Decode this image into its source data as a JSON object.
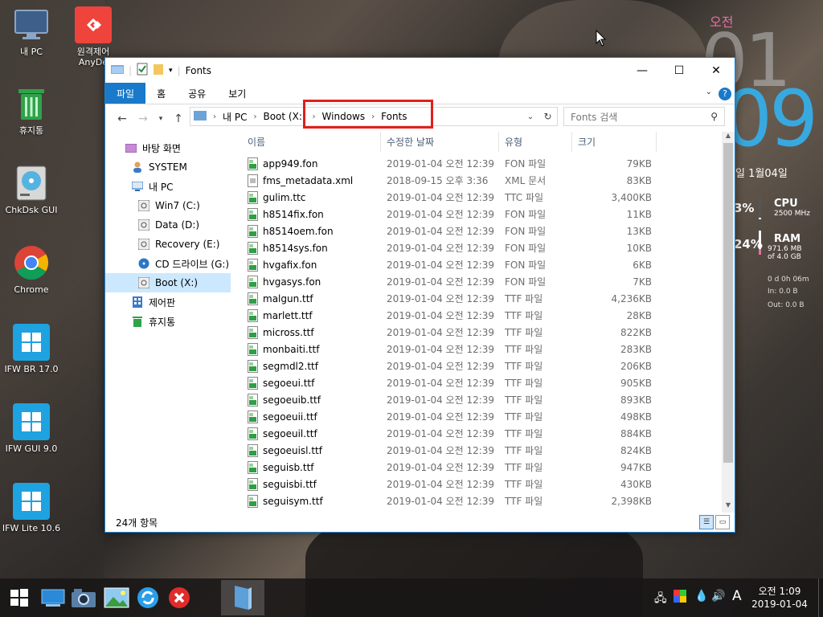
{
  "desktop": {
    "icons": [
      {
        "label": "내 PC"
      },
      {
        "label": "원격제어\nAnyDe"
      },
      {
        "label": "휴지통"
      },
      {
        "label": "ChkDsk GUI"
      },
      {
        "label": "Chrome"
      },
      {
        "label": "IFW BR 17.0"
      },
      {
        "label": "IFW GUI 9.0"
      },
      {
        "label": "IFW Lite 10.6"
      }
    ]
  },
  "widget": {
    "ampm": "오전",
    "hour": "01",
    "minute": "09",
    "date": "일 1월04일",
    "cpu": {
      "pct": "3%",
      "title": "CPU",
      "sub": "2500 MHz",
      "level": 0.03
    },
    "ram": {
      "pct": "24%",
      "title": "RAM",
      "sub1": "971.6 MB",
      "sub2": "of  4.0 GB",
      "level": 0.24
    },
    "uptime": "0 d 0h 06m",
    "net_in": "In: 0.0 B",
    "net_out": "Out: 0.0 B"
  },
  "window": {
    "title": "Fonts",
    "tabs": [
      "파일",
      "홈",
      "공유",
      "보기"
    ],
    "help": "?",
    "breadcrumb": [
      "내 PC",
      "Boot (X:)",
      "Windows",
      "Fonts"
    ],
    "search_placeholder": "Fonts 검색",
    "nav": [
      {
        "label": "바탕 화면",
        "icon": "desktop-icon"
      },
      {
        "label": "SYSTEM",
        "icon": "user-icon"
      },
      {
        "label": "내 PC",
        "icon": "pc-icon"
      },
      {
        "label": "Win7 (C:)",
        "icon": "drive-icon"
      },
      {
        "label": "Data (D:)",
        "icon": "drive-icon"
      },
      {
        "label": "Recovery (E:)",
        "icon": "drive-icon"
      },
      {
        "label": "CD 드라이브 (G:)",
        "icon": "cd-icon"
      },
      {
        "label": "Boot (X:)",
        "icon": "drive-icon"
      },
      {
        "label": "제어판",
        "icon": "control-panel-icon"
      },
      {
        "label": "휴지통",
        "icon": "recycle-bin-icon"
      }
    ],
    "columns": [
      "이름",
      "수정한 날짜",
      "유형",
      "크기"
    ],
    "files": [
      {
        "name": "app949.fon",
        "date": "2019-01-04 오전 12:39",
        "type": "FON 파일",
        "size": "79KB",
        "kind": "fon"
      },
      {
        "name": "fms_metadata.xml",
        "date": "2018-09-15 오후 3:36",
        "type": "XML 문서",
        "size": "83KB",
        "kind": "xml"
      },
      {
        "name": "gulim.ttc",
        "date": "2019-01-04 오전 12:39",
        "type": "TTC 파일",
        "size": "3,400KB",
        "kind": "ttf"
      },
      {
        "name": "h8514fix.fon",
        "date": "2019-01-04 오전 12:39",
        "type": "FON 파일",
        "size": "11KB",
        "kind": "fon"
      },
      {
        "name": "h8514oem.fon",
        "date": "2019-01-04 오전 12:39",
        "type": "FON 파일",
        "size": "13KB",
        "kind": "fon"
      },
      {
        "name": "h8514sys.fon",
        "date": "2019-01-04 오전 12:39",
        "type": "FON 파일",
        "size": "10KB",
        "kind": "fon"
      },
      {
        "name": "hvgafix.fon",
        "date": "2019-01-04 오전 12:39",
        "type": "FON 파일",
        "size": "6KB",
        "kind": "fon"
      },
      {
        "name": "hvgasys.fon",
        "date": "2019-01-04 오전 12:39",
        "type": "FON 파일",
        "size": "7KB",
        "kind": "fon"
      },
      {
        "name": "malgun.ttf",
        "date": "2019-01-04 오전 12:39",
        "type": "TTF 파일",
        "size": "4,236KB",
        "kind": "ttf"
      },
      {
        "name": "marlett.ttf",
        "date": "2019-01-04 오전 12:39",
        "type": "TTF 파일",
        "size": "28KB",
        "kind": "ttf"
      },
      {
        "name": "micross.ttf",
        "date": "2019-01-04 오전 12:39",
        "type": "TTF 파일",
        "size": "822KB",
        "kind": "ttf"
      },
      {
        "name": "monbaiti.ttf",
        "date": "2019-01-04 오전 12:39",
        "type": "TTF 파일",
        "size": "283KB",
        "kind": "ttf"
      },
      {
        "name": "segmdl2.ttf",
        "date": "2019-01-04 오전 12:39",
        "type": "TTF 파일",
        "size": "206KB",
        "kind": "ttf"
      },
      {
        "name": "segoeui.ttf",
        "date": "2019-01-04 오전 12:39",
        "type": "TTF 파일",
        "size": "905KB",
        "kind": "ttf"
      },
      {
        "name": "segoeuib.ttf",
        "date": "2019-01-04 오전 12:39",
        "type": "TTF 파일",
        "size": "893KB",
        "kind": "ttf"
      },
      {
        "name": "segoeuii.ttf",
        "date": "2019-01-04 오전 12:39",
        "type": "TTF 파일",
        "size": "498KB",
        "kind": "ttf"
      },
      {
        "name": "segoeuil.ttf",
        "date": "2019-01-04 오전 12:39",
        "type": "TTF 파일",
        "size": "884KB",
        "kind": "ttf"
      },
      {
        "name": "segoeuisl.ttf",
        "date": "2019-01-04 오전 12:39",
        "type": "TTF 파일",
        "size": "824KB",
        "kind": "ttf"
      },
      {
        "name": "seguisb.ttf",
        "date": "2019-01-04 오전 12:39",
        "type": "TTF 파일",
        "size": "947KB",
        "kind": "ttf"
      },
      {
        "name": "seguisbi.ttf",
        "date": "2019-01-04 오전 12:39",
        "type": "TTF 파일",
        "size": "430KB",
        "kind": "ttf"
      },
      {
        "name": "seguisym.ttf",
        "date": "2019-01-04 오전 12:39",
        "type": "TTF 파일",
        "size": "2,398KB",
        "kind": "ttf"
      }
    ],
    "status": "24개 항목"
  },
  "taskbar": {
    "tray_lang": "A",
    "time": "오전 1:09",
    "date": "2019-01-04"
  },
  "colors": {
    "accent": "#1979ca",
    "highlight_box": "#e0201b",
    "clock_minute": "#37a9e0",
    "clock_ampm": "#e86fa5"
  }
}
